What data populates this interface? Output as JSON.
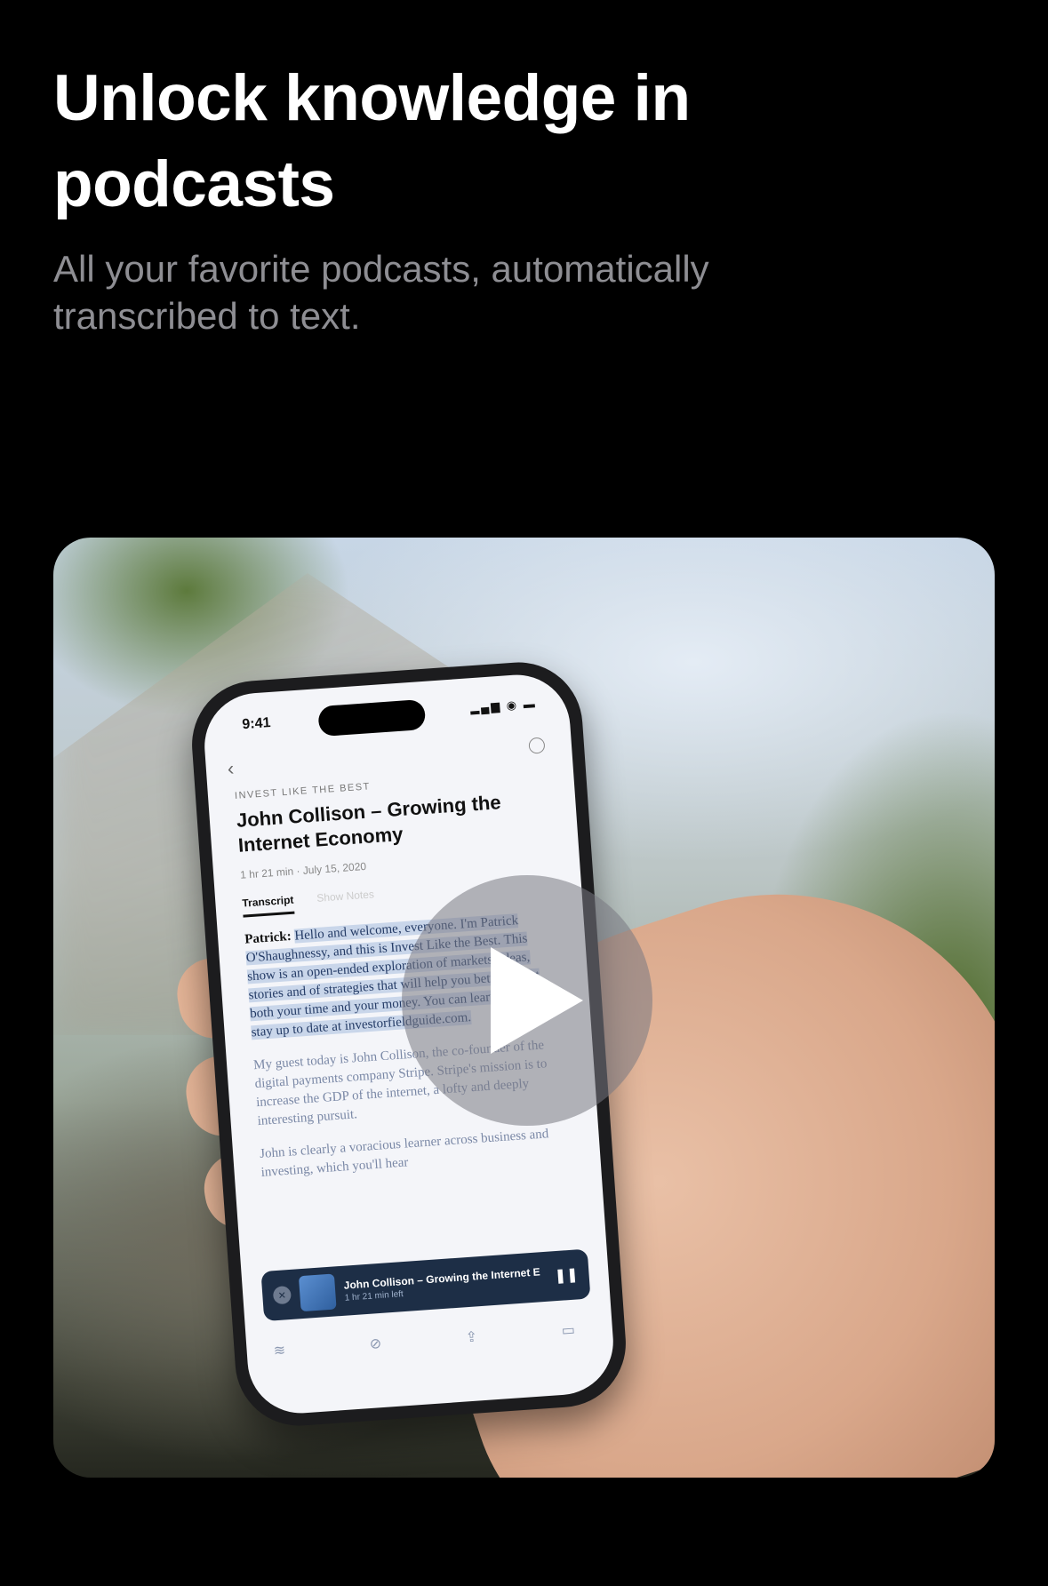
{
  "header": {
    "title": "Unlock knowledge in podcasts",
    "subtitle": "All your favorite podcasts, automatically transcribed to text."
  },
  "video": {
    "play_icon": "play-icon",
    "phone": {
      "status_time": "9:41",
      "show_name": "INVEST LIKE THE BEST",
      "episode_title": "John Collison – Growing the Internet Economy",
      "episode_meta": "1 hr 21 min · July 15, 2020",
      "tabs": [
        "Transcript",
        "Show Notes"
      ],
      "transcript": {
        "speaker": "Patrick:",
        "para1": "Hello and welcome, everyone. I'm Patrick O'Shaughnessy, and this is Invest Like the Best. This show is an open-ended exploration of markets, ideas, stories and of strategies that will help you better invest both your time and your money. You can learn more and stay up to date at investorfieldguide.com.",
        "para2": "My guest today is John Collison, the co-founder of the digital payments company Stripe. Stripe's mission is to increase the GDP of the internet, a lofty and deeply interesting pursuit.",
        "para3": "John is clearly a voracious learner across business and investing, which you'll hear"
      },
      "mini_player": {
        "title": "John Collison – Growing the Internet E",
        "subtitle": "1 hr 21 min left"
      }
    }
  }
}
